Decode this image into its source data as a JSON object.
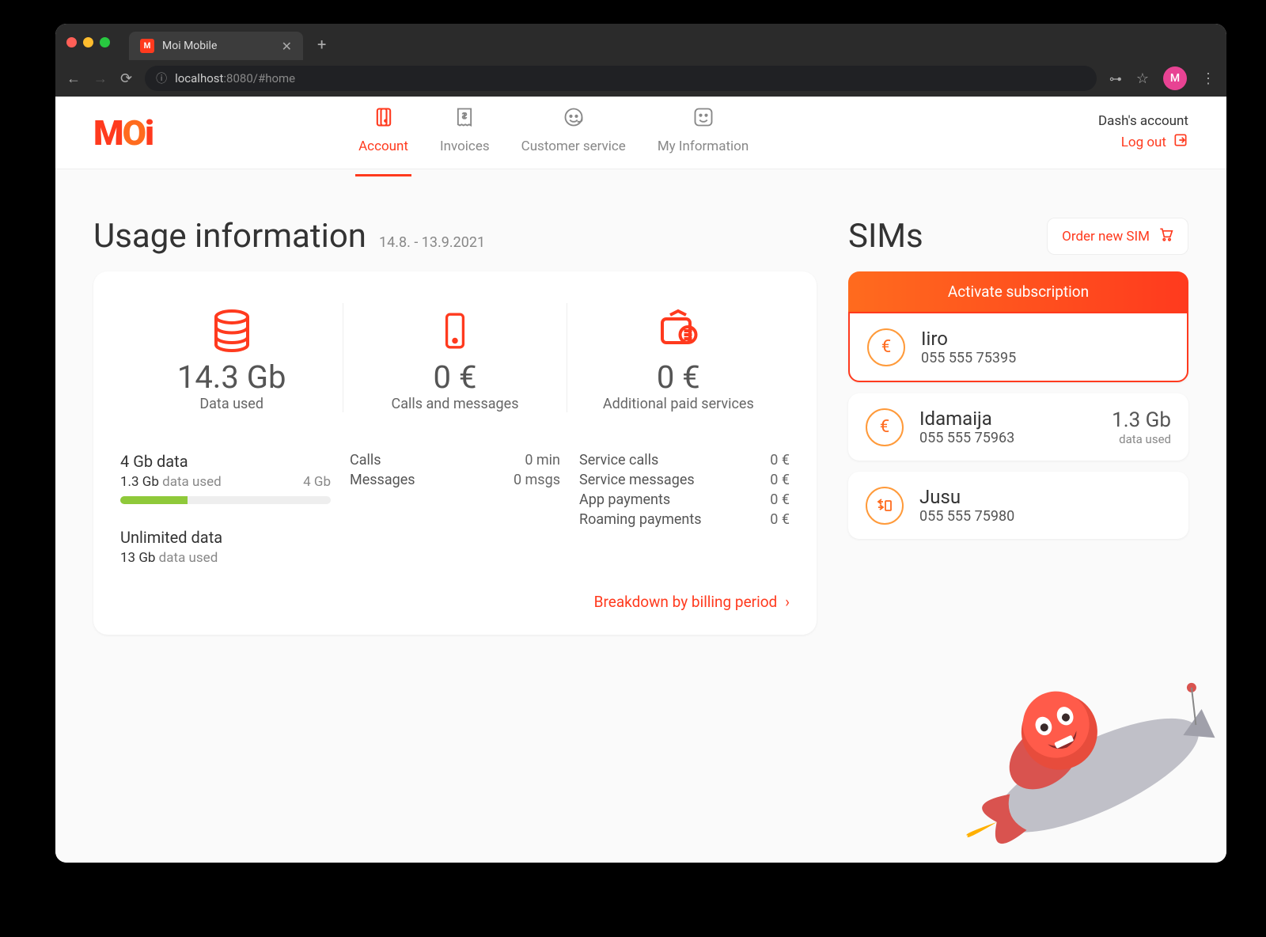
{
  "browser": {
    "tab_title": "Moi Mobile",
    "url_host": "localhost",
    "url_port": ":8080",
    "url_path": "/#home",
    "avatar_letter": "M"
  },
  "header": {
    "logo": "MOi",
    "nav": {
      "account": "Account",
      "invoices": "Invoices",
      "customer_service": "Customer service",
      "my_information": "My Information"
    },
    "account_name": "Dash's account",
    "logout": "Log out"
  },
  "usage": {
    "title": "Usage information",
    "period": "14.8. - 13.9.2021",
    "data": {
      "value": "14.3 Gb",
      "label": "Data used"
    },
    "calls": {
      "value": "0 €",
      "label": "Calls and messages"
    },
    "services": {
      "value": "0 €",
      "label": "Additional paid services"
    },
    "plans": [
      {
        "name": "4 Gb data",
        "used": "1.3 Gb",
        "used_label": "data used",
        "cap": "4 Gb",
        "has_progress": true
      },
      {
        "name": "Unlimited data",
        "used": "13 Gb",
        "used_label": "data used",
        "has_progress": false
      }
    ],
    "call_rows": [
      {
        "label": "Calls",
        "value": "0 min"
      },
      {
        "label": "Messages",
        "value": "0 msgs"
      }
    ],
    "service_rows": [
      {
        "label": "Service calls",
        "value": "0 €"
      },
      {
        "label": "Service messages",
        "value": "0 €"
      },
      {
        "label": "App payments",
        "value": "0 €"
      },
      {
        "label": "Roaming payments",
        "value": "0 €"
      }
    ],
    "breakdown_link": "Breakdown by billing period"
  },
  "sims": {
    "title": "SIMs",
    "order_button": "Order new SIM",
    "activate_button": "Activate subscription",
    "list": [
      {
        "name": "Iiro",
        "phone": "055 555 75395",
        "icon": "euro",
        "active": true
      },
      {
        "name": "Idamaija",
        "phone": "055 555 75963",
        "icon": "euro",
        "data_value": "1.3 Gb",
        "data_label": "data used"
      },
      {
        "name": "Jusu",
        "phone": "055 555 75980",
        "icon": "sim"
      }
    ]
  }
}
